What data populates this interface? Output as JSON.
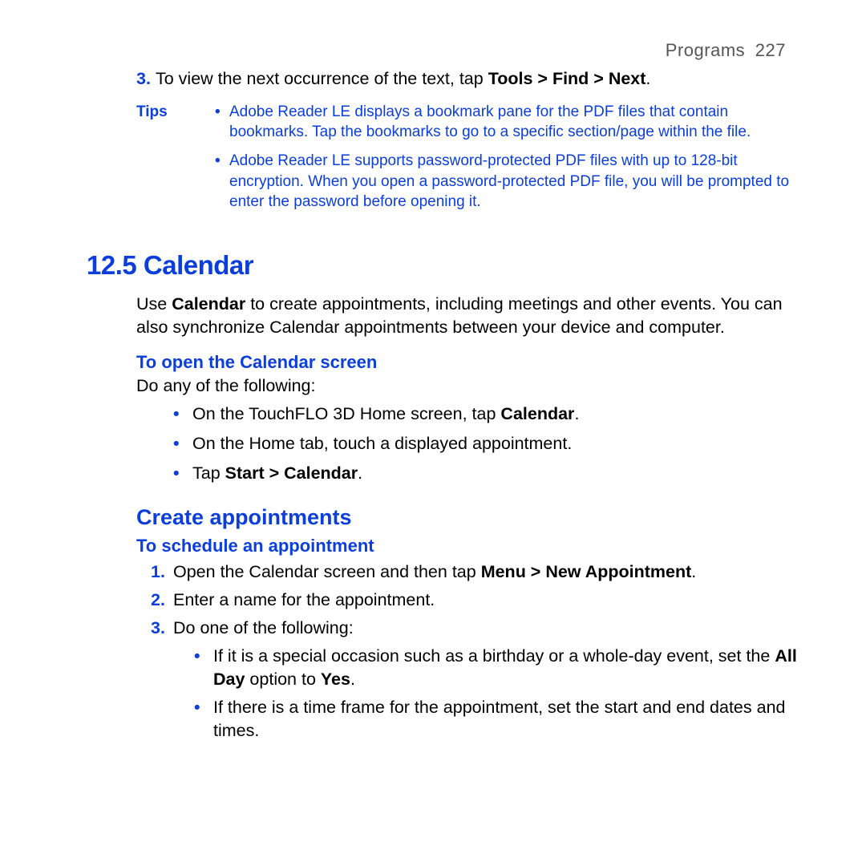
{
  "header": {
    "section": "Programs",
    "page": "227"
  },
  "top_item": {
    "num": "3.",
    "t1": "To view the next occurrence of the text, tap ",
    "b1": "Tools > Find > Next",
    "t2": "."
  },
  "tips_label": "Tips",
  "tips": [
    "Adobe Reader LE displays a bookmark pane for the PDF files that contain bookmarks. Tap the bookmarks to go to a specific section/page within the file.",
    "Adobe Reader LE supports password-protected PDF files with up to 128-bit encryption. When you open a password-protected PDF file, you will be prompted to enter the password before opening it."
  ],
  "h1": "12.5  Calendar",
  "intro": {
    "t1": "Use ",
    "b1": "Calendar",
    "t2": " to create appointments, including meetings and other events. You can also synchronize Calendar appointments between your device and computer."
  },
  "open_heading": "To open the Calendar screen",
  "open_intro": "Do any of the following:",
  "open_bullets": {
    "b1": {
      "t1": "On the TouchFLO 3D Home screen, tap ",
      "b1": "Calendar",
      "t2": "."
    },
    "b2": "On the Home tab, touch a displayed appointment.",
    "b3": {
      "t1": "Tap ",
      "b1": "Start > Calendar",
      "t2": "."
    }
  },
  "h2": "Create appointments",
  "h3": "To schedule an appointment",
  "steps": {
    "s1": {
      "num": "1.",
      "t1": "Open the Calendar screen and then tap ",
      "b1": "Menu > New Appointment",
      "t2": "."
    },
    "s2": {
      "num": "2.",
      "txt": "Enter a name for the appointment."
    },
    "s3": {
      "num": "3.",
      "txt": "Do one of the following:"
    }
  },
  "sub": {
    "a": {
      "t1": "If it is a special occasion such as a birthday or a whole-day event, set the ",
      "b1": "All Day",
      "t2": " option to ",
      "b2": "Yes",
      "t3": "."
    },
    "b": "If there is a time frame for the appointment, set the start and end dates and times."
  }
}
